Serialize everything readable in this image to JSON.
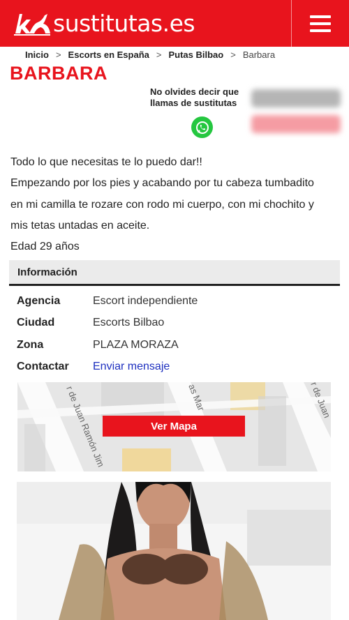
{
  "header": {
    "site_name": "sustitutas.es",
    "logo_icon": "silhouette-logo-icon",
    "menu_icon": "hamburger-menu-icon",
    "brand_color": "#e8141d"
  },
  "breadcrumb": {
    "items": [
      "Inicio",
      "Escorts en España",
      "Putas Bilbao"
    ],
    "current": "Barbara",
    "separator": ">"
  },
  "profile": {
    "name": "BARBARA",
    "reminder_line1": "No olvides decir que",
    "reminder_line2": "llamas de sustitutas",
    "contact_icon": "whatsapp-icon",
    "description": [
      "Todo lo que necesitas te lo puedo dar!!",
      "Empezando por los pies y acabando por tu cabeza tumbadito",
      "en mi camilla te rozare con rodo mi cuerpo, con mi chochito y",
      "mis tetas untadas en aceite.",
      "Edad 29 años"
    ]
  },
  "info": {
    "title": "Información",
    "rows": [
      {
        "label": "Agencia",
        "value": "Escort independiente"
      },
      {
        "label": "Ciudad",
        "value": "Escorts Bilbao"
      },
      {
        "label": "Zona",
        "value": "PLAZA MORAZA"
      },
      {
        "label": "Contactar",
        "value": "Enviar mensaje"
      }
    ]
  },
  "map": {
    "button_label": "Ver Mapa",
    "street_labels": [
      "r de Juan Ramón Jim",
      "as Mar",
      "r de Juan"
    ]
  }
}
